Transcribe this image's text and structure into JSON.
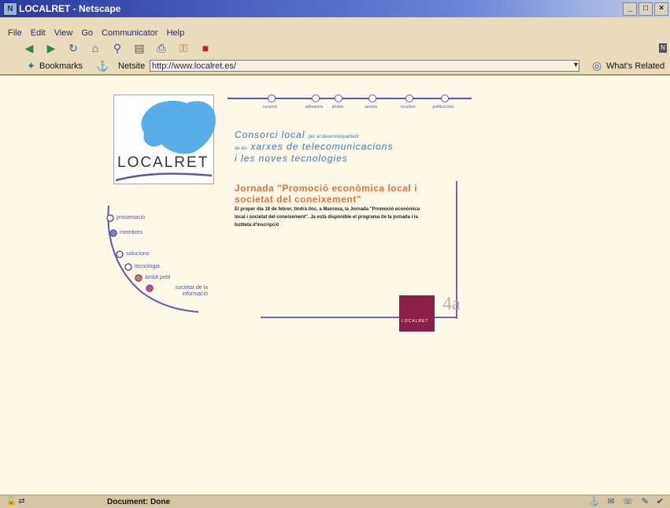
{
  "window": {
    "title": "LOCALRET - Netscape",
    "min_label": "_",
    "max_label": "□",
    "close_label": "×"
  },
  "menu": [
    "File",
    "Edit",
    "View",
    "Go",
    "Communicator",
    "Help"
  ],
  "location": {
    "bookmarks_label": "Bookmarks",
    "netsite_label": "Netsite",
    "url": "http://www.localret.es/",
    "whats_related": "What's Related"
  },
  "page": {
    "logo": "LOCALRET",
    "topnav": [
      "consorci",
      "adhesions",
      "àmbits",
      "serveis",
      "recursos",
      "publicacions"
    ],
    "tagline": {
      "line1": "Consorci local",
      "line1_small": "per al desenvolupament",
      "line2_small": "de les",
      "line2": "xarxes de telecomunicacions",
      "line3": "i les noves tecnologies"
    },
    "news": {
      "title": "Jornada \"Promoció econòmica local i societat del coneixement\"",
      "body": "El proper dia 18 de febrer, tindrà lloc, a Manresa, la Jornada \"Promoció econòmica local i societat del coneixement\". Ja està disponible el programa de la jornada i la butlleta d'inscripció"
    },
    "sidenav": [
      "presentació",
      "membres",
      "solucions",
      "tecnologia",
      "àmbit petit",
      "societat de la informació"
    ],
    "ad": {
      "badge": "LOCALRET",
      "text": "4a"
    }
  },
  "status": {
    "text": "Document: Done"
  },
  "colors": {
    "brand_purple": "#5a5aa8",
    "accent_orange": "#e56f3d",
    "tagline_blue": "#3a78c8",
    "badge": "#8a1f48"
  }
}
